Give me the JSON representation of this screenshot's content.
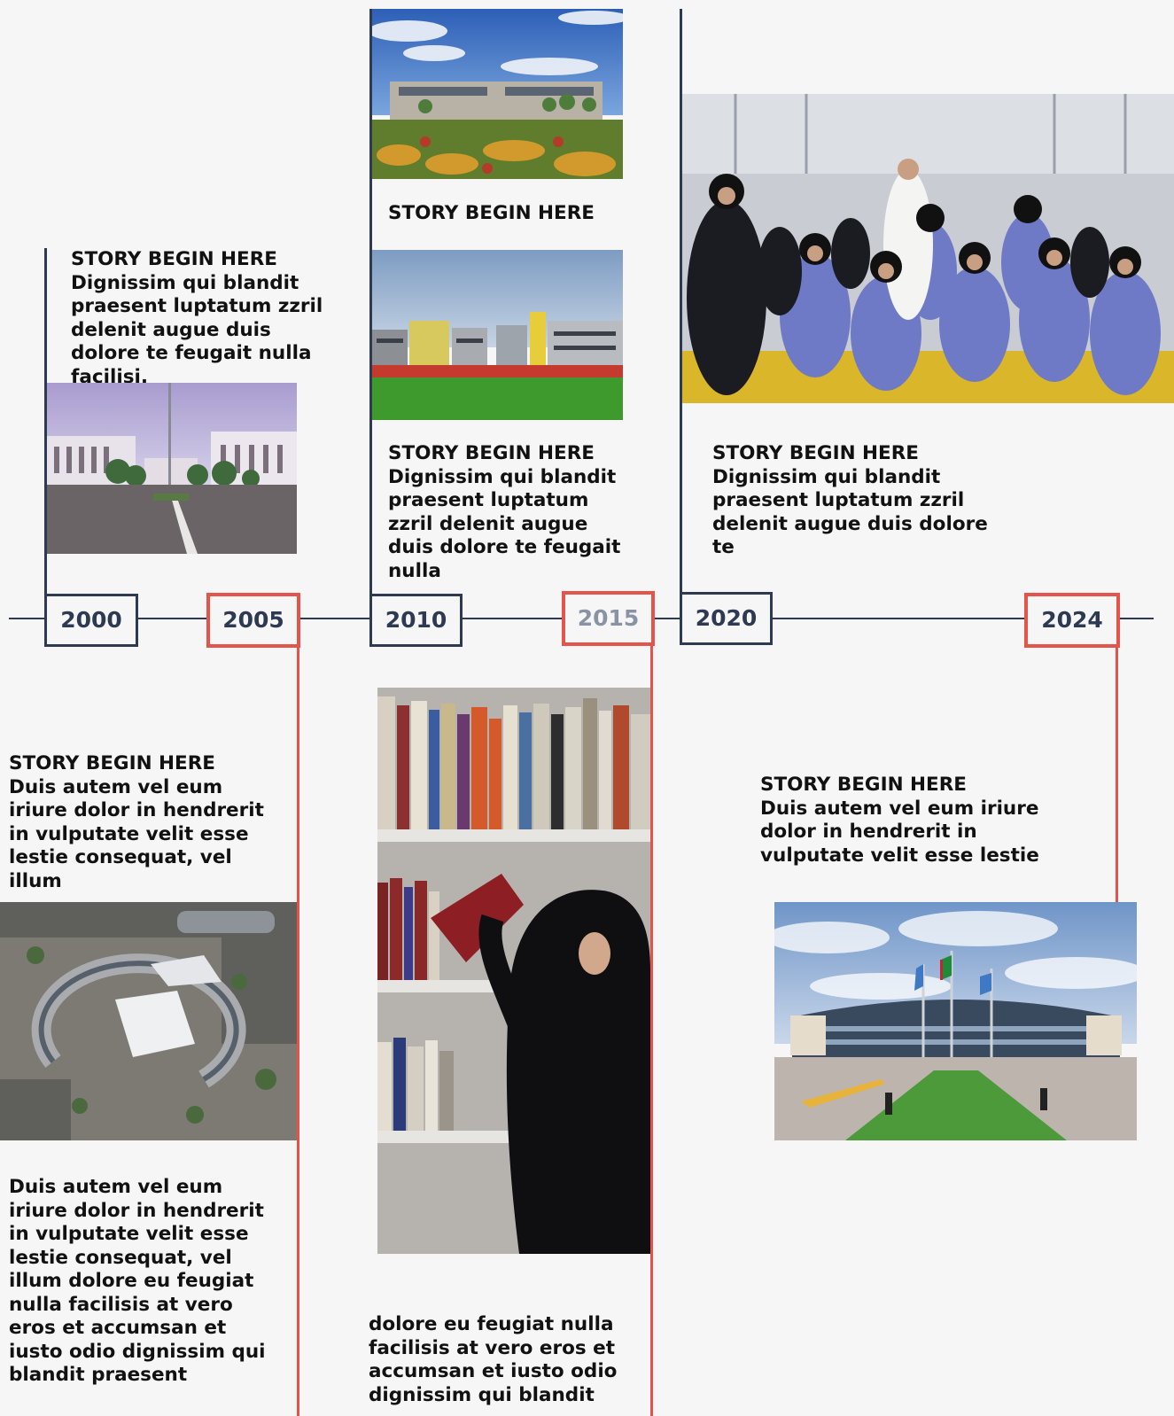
{
  "timeline": {
    "years": [
      {
        "label": "2000"
      },
      {
        "label": "2005"
      },
      {
        "label": "2010"
      },
      {
        "label": "2015"
      },
      {
        "label": "2020"
      },
      {
        "label": "2024"
      }
    ]
  },
  "stories": {
    "s2000": {
      "heading": "STORY BEGIN HERE",
      "body": "Dignissim qui blandit praesent luptatum zzril delenit augue duis dolore te feugait nulla facilisi."
    },
    "s2010_caption": {
      "heading": "STORY BEGIN HERE"
    },
    "s2010": {
      "heading": "STORY BEGIN HERE",
      "body": "Dignissim qui blandit praesent luptatum zzril delenit augue duis dolore te feugait nulla"
    },
    "s2020": {
      "heading": "STORY BEGIN HERE",
      "body": "Dignissim qui blandit praesent luptatum zzril delenit augue duis dolore te"
    },
    "s2005": {
      "heading": "STORY BEGIN HERE",
      "body": "Duis autem vel eum iriure dolor in hendrerit in vulputate velit esse lestie consequat, vel illum"
    },
    "s2005_more": {
      "body": "Duis autem vel eum iriure dolor in hendrerit in vulputate velit esse lestie consequat, vel illum dolore eu feugiat nulla facilisis at vero eros et accumsan et iusto odio dignissim qui blandit praesent"
    },
    "s2015_more": {
      "body": "dolore eu feugiat nulla facilisis at vero eros et accumsan et iusto odio dignissim qui blandit"
    },
    "s2024": {
      "heading": "STORY BEGIN HERE",
      "body": "Duis autem vel eum iriure dolor in hendrerit in vulputate velit esse lestie"
    }
  },
  "colors": {
    "navy": "#2d3a52",
    "accent": "#e4544b",
    "background": "#f6f6f7"
  }
}
